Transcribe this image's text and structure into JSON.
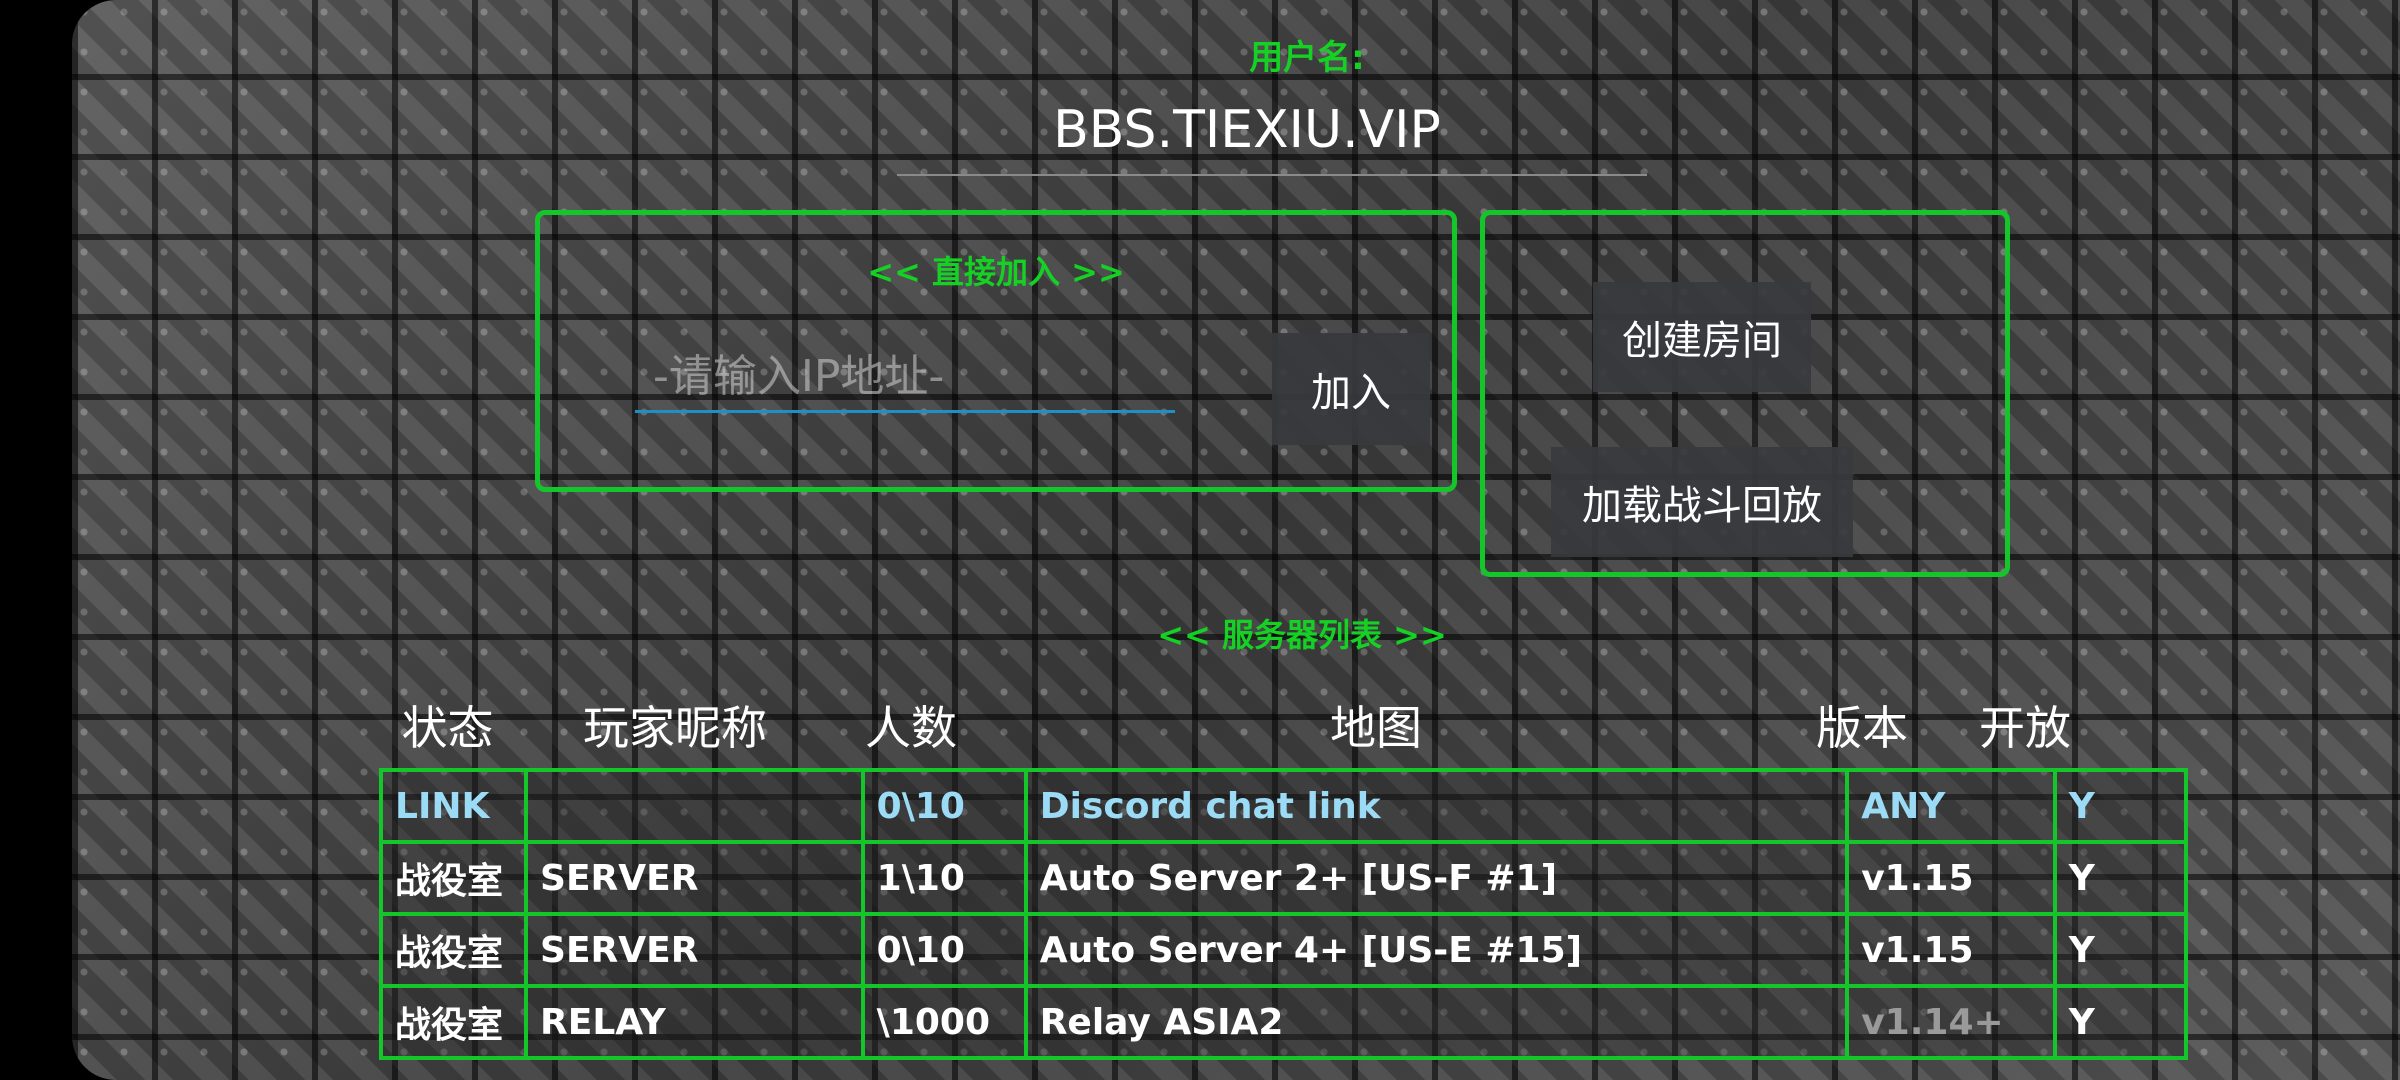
{
  "username": {
    "label": "用户名:",
    "value": "BBS.TIEXIU.VIP"
  },
  "direct_join": {
    "title": "<< 直接加入 >>",
    "ip_placeholder": "-请输入IP地址-",
    "join_label": "加入"
  },
  "room": {
    "create_label": "创建房间",
    "load_replay_label": "加载战斗回放"
  },
  "server_list": {
    "title": "<< 服务器列表 >>",
    "columns": [
      "状态",
      "玩家昵称",
      "人数",
      "地图",
      "版本",
      "开放"
    ],
    "rows": [
      [
        "LINK",
        "",
        "0\\10",
        "Discord chat link",
        "ANY",
        "Y"
      ],
      [
        "战役室",
        "SERVER",
        "1\\10",
        "Auto Server 2+ [US-F #1]",
        "v1.15",
        "Y"
      ],
      [
        "战役室",
        "SERVER",
        "0\\10",
        "Auto Server 4+ [US-E #15]",
        "v1.15",
        "Y"
      ],
      [
        "战役室",
        "RELAY",
        "\\1000",
        "Relay ASIA2",
        "v1.14+",
        "Y"
      ]
    ]
  },
  "colors": {
    "accent_green": "#14d124",
    "link_blue": "#9bdbf5",
    "input_underline": "#1f8fc8"
  }
}
